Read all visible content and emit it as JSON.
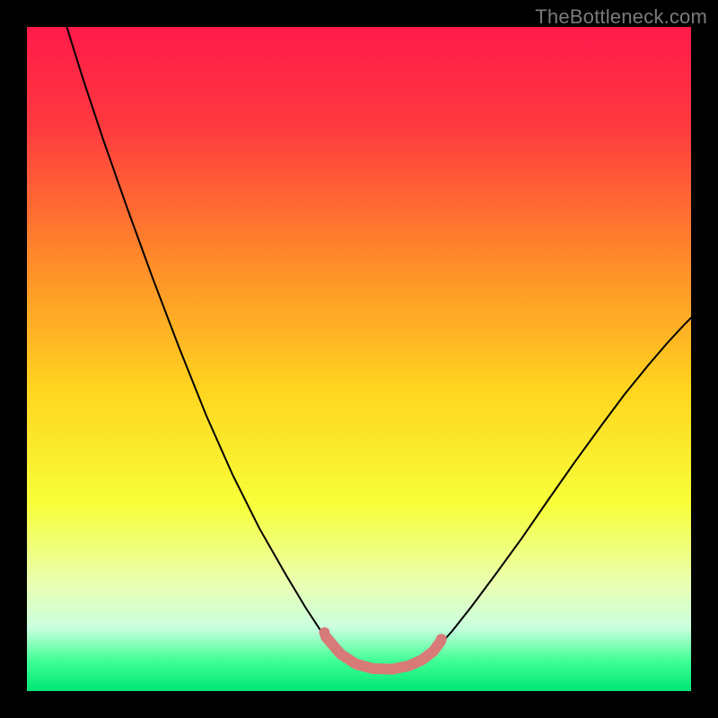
{
  "watermark": {
    "text": "TheBottleneck.com"
  },
  "chart_data": {
    "type": "line",
    "title": "",
    "xlabel": "",
    "ylabel": "",
    "xlim": [
      0,
      100
    ],
    "ylim": [
      0,
      100
    ],
    "grid": false,
    "legend": false,
    "gradient_stops": [
      {
        "offset": 0.0,
        "color": "#ff1a4b"
      },
      {
        "offset": 0.15,
        "color": "#ff3a3f"
      },
      {
        "offset": 0.35,
        "color": "#ff8a2a"
      },
      {
        "offset": 0.55,
        "color": "#ffd61f"
      },
      {
        "offset": 0.72,
        "color": "#f7ff3a"
      },
      {
        "offset": 0.84,
        "color": "#e9ffb3"
      },
      {
        "offset": 0.905,
        "color": "#c9ffdf"
      },
      {
        "offset": 0.955,
        "color": "#3fff94"
      },
      {
        "offset": 1.0,
        "color": "#00e676"
      }
    ],
    "series": [
      {
        "name": "left-curve",
        "stroke": "#000000",
        "stroke_width": 2,
        "points": [
          {
            "x": 6.0,
            "y": 100.0
          },
          {
            "x": 8.5,
            "y": 92.0
          },
          {
            "x": 11.5,
            "y": 83.0
          },
          {
            "x": 15.0,
            "y": 73.0
          },
          {
            "x": 19.0,
            "y": 62.0
          },
          {
            "x": 23.0,
            "y": 51.5
          },
          {
            "x": 27.0,
            "y": 41.5
          },
          {
            "x": 31.0,
            "y": 32.5
          },
          {
            "x": 35.0,
            "y": 24.5
          },
          {
            "x": 39.0,
            "y": 17.5
          },
          {
            "x": 42.0,
            "y": 12.5
          },
          {
            "x": 44.5,
            "y": 8.7
          },
          {
            "x": 46.5,
            "y": 6.2
          }
        ]
      },
      {
        "name": "right-curve",
        "stroke": "#000000",
        "stroke_width": 2,
        "points": [
          {
            "x": 61.5,
            "y": 6.2
          },
          {
            "x": 64.0,
            "y": 9.0
          },
          {
            "x": 67.0,
            "y": 12.8
          },
          {
            "x": 70.5,
            "y": 17.5
          },
          {
            "x": 74.5,
            "y": 23.0
          },
          {
            "x": 78.5,
            "y": 28.8
          },
          {
            "x": 82.5,
            "y": 34.5
          },
          {
            "x": 86.5,
            "y": 40.0
          },
          {
            "x": 90.0,
            "y": 44.7
          },
          {
            "x": 93.5,
            "y": 49.0
          },
          {
            "x": 96.5,
            "y": 52.5
          },
          {
            "x": 99.0,
            "y": 55.2
          },
          {
            "x": 100.0,
            "y": 56.2
          }
        ]
      },
      {
        "name": "bottom-highlight",
        "stroke": "#d87a78",
        "stroke_width": 12,
        "linecap": "round",
        "points": [
          {
            "x": 45.0,
            "y": 8.2
          },
          {
            "x": 47.2,
            "y": 5.6
          },
          {
            "x": 49.5,
            "y": 4.1
          },
          {
            "x": 52.0,
            "y": 3.4
          },
          {
            "x": 55.0,
            "y": 3.3
          },
          {
            "x": 57.5,
            "y": 3.8
          },
          {
            "x": 59.5,
            "y": 4.7
          },
          {
            "x": 61.2,
            "y": 6.0
          },
          {
            "x": 62.3,
            "y": 7.5
          }
        ]
      }
    ],
    "highlight_dots": {
      "fill": "#d87a78",
      "radius": 6,
      "points": [
        {
          "x": 44.8,
          "y": 8.8
        },
        {
          "x": 62.4,
          "y": 7.8
        }
      ]
    }
  }
}
